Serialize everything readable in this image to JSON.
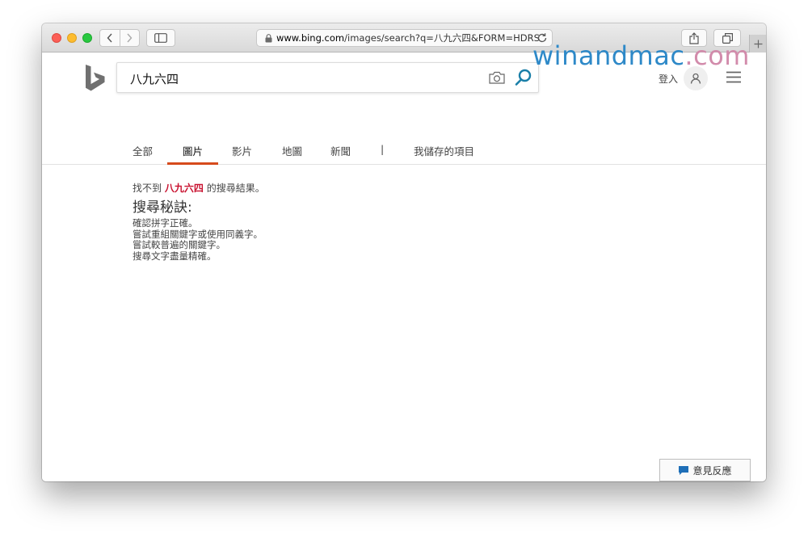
{
  "browser": {
    "url_host": "www.bing.com",
    "url_path": "/images/search?q=八九六四&FORM=HDRS"
  },
  "header": {
    "search_value": "八九六四",
    "signin_label": "登入"
  },
  "scopes": [
    {
      "label": "全部"
    },
    {
      "label": "圖片"
    },
    {
      "label": "影片"
    },
    {
      "label": "地圖"
    },
    {
      "label": "新聞"
    },
    {
      "label": "|"
    },
    {
      "label": "我儲存的項目"
    }
  ],
  "results": {
    "noresult_prefix": "找不到",
    "query": "八九六四",
    "noresult_suffix": "的搜尋結果。",
    "tips_title": "搜尋秘訣:",
    "tips": [
      "確認拼字正確。",
      "嘗試重組關鍵字或使用同義字。",
      "嘗試較普遍的關鍵字。",
      "搜尋文字盡量精確。"
    ]
  },
  "feedback_label": "意見反應",
  "watermark": {
    "part1": "winandmac",
    "part2": ".com"
  },
  "colors": {
    "accent": "#d64a1c",
    "query": "#c8102e",
    "search_icon": "#1a7fa8"
  }
}
